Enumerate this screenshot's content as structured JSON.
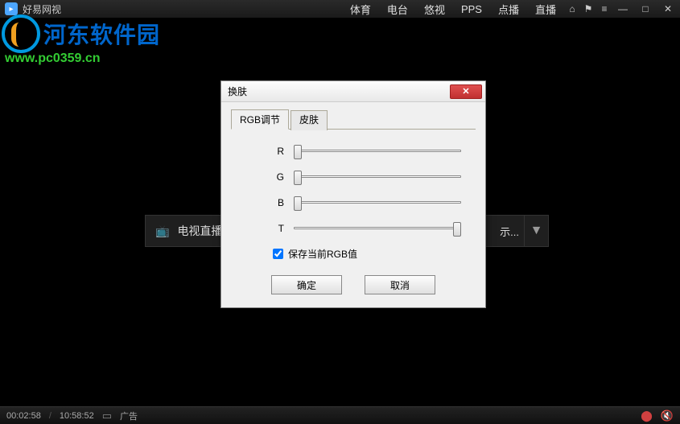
{
  "titlebar": {
    "app_title": "好易网视",
    "nav": [
      "体育",
      "电台",
      "悠视",
      "PPS",
      "点播",
      "直播"
    ]
  },
  "watermark": {
    "site_name": "河东软件园",
    "url": "www.pc0359.cn"
  },
  "tv_button": {
    "label": "电视直播"
  },
  "dropdown": {
    "label": "示..."
  },
  "dialog": {
    "title": "换肤",
    "tabs": [
      "RGB调节",
      "皮肤"
    ],
    "sliders": {
      "r": "R",
      "g": "G",
      "b": "B",
      "t": "T"
    },
    "checkbox_label": "保存当前RGB值",
    "ok_label": "确定",
    "cancel_label": "取消"
  },
  "statusbar": {
    "elapsed": "00:02:58",
    "total": "10:58:52",
    "separator": "/",
    "ad_label": "广告"
  },
  "colors": {
    "accent": "#4da6ff",
    "dialog_bg": "#f0f0f0",
    "close_red": "#c03030"
  }
}
